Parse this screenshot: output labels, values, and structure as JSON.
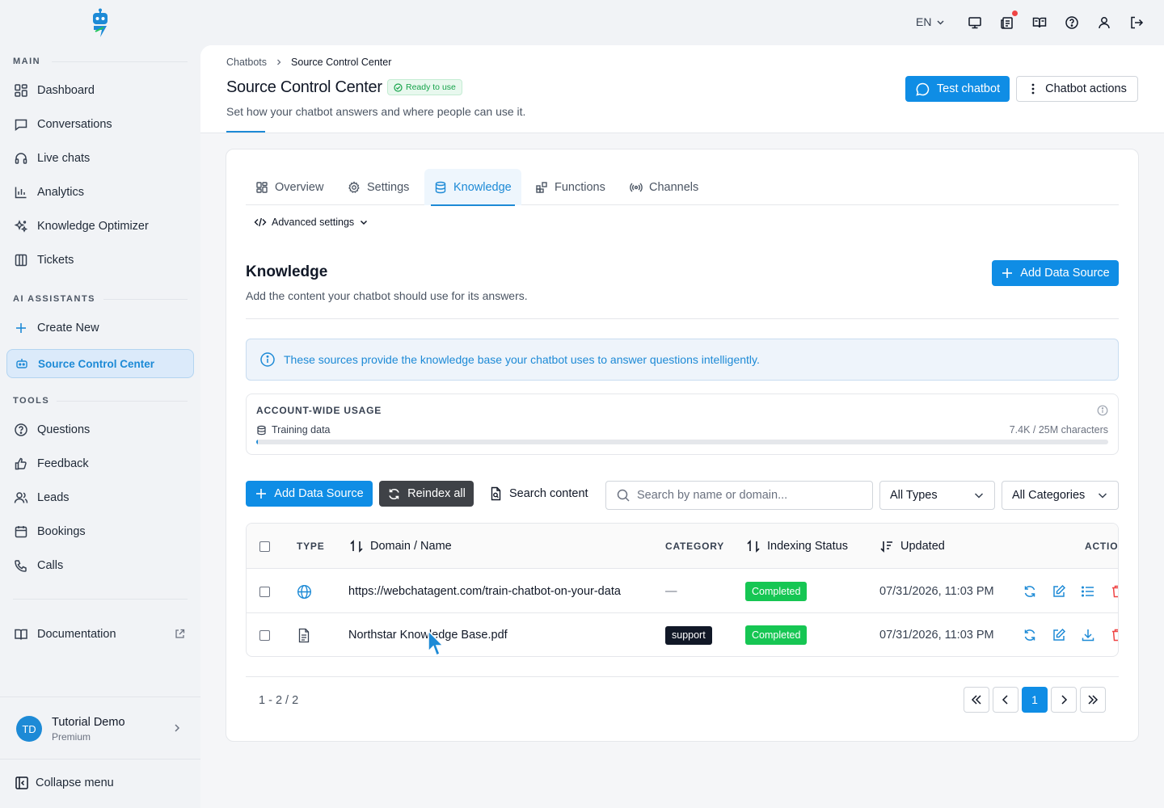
{
  "sidebar": {
    "sections": {
      "main": "MAIN",
      "ai_assistants": "AI ASSISTANTS",
      "tools": "TOOLS"
    },
    "main_items": [
      {
        "label": "Dashboard",
        "icon": "dashboard-icon"
      },
      {
        "label": "Conversations",
        "icon": "chat-icon"
      },
      {
        "label": "Live chats",
        "icon": "headset-icon"
      },
      {
        "label": "Analytics",
        "icon": "bar-chart-icon"
      },
      {
        "label": "Knowledge Optimizer",
        "icon": "sparkles-icon"
      },
      {
        "label": "Tickets",
        "icon": "columns-icon"
      }
    ],
    "create_new": "Create New",
    "active_assistant": "Source Control Center",
    "tool_items": [
      {
        "label": "Questions",
        "icon": "question-icon"
      },
      {
        "label": "Feedback",
        "icon": "thumbs-up-icon"
      },
      {
        "label": "Leads",
        "icon": "users-icon"
      },
      {
        "label": "Bookings",
        "icon": "calendar-icon"
      },
      {
        "label": "Calls",
        "icon": "phone-icon"
      }
    ],
    "documentation": "Documentation",
    "user": {
      "initials": "TD",
      "name": "Tutorial Demo",
      "plan": "Premium"
    },
    "collapse": "Collapse menu"
  },
  "topbar": {
    "language": "EN",
    "accent_dot_color": "#ef4444"
  },
  "header": {
    "breadcrumb": [
      "Chatbots",
      "Source Control Center"
    ],
    "title": "Source Control Center",
    "status_badge": "Ready to use",
    "subtitle": "Set how your chatbot answers and where people can use it.",
    "test_button": "Test chatbot",
    "actions_button": "Chatbot actions"
  },
  "tabs": [
    {
      "label": "Overview",
      "icon": "grid-icon"
    },
    {
      "label": "Settings",
      "icon": "gear-icon"
    },
    {
      "label": "Knowledge",
      "icon": "database-icon"
    },
    {
      "label": "Functions",
      "icon": "blocks-icon"
    },
    {
      "label": "Channels",
      "icon": "broadcast-icon"
    }
  ],
  "advanced_settings": "Advanced settings",
  "knowledge": {
    "title": "Knowledge",
    "subtitle": "Add the content your chatbot should use for its answers.",
    "add_source": "Add Data Source",
    "info": "These sources provide the knowledge base your chatbot uses to answer questions intelligently."
  },
  "usage": {
    "title": "ACCOUNT-WIDE USAGE",
    "label": "Training data",
    "value": "7.4K / 25M characters",
    "fraction": 0.0003
  },
  "toolbar": {
    "add_source": "Add Data Source",
    "reindex": "Reindex all",
    "search_content": "Search content",
    "search_placeholder": "Search by name or domain...",
    "type_filter": "All Types",
    "category_filter": "All Categories"
  },
  "table": {
    "columns": {
      "type": "TYPE",
      "name": "Domain / Name",
      "category": "CATEGORY",
      "status": "Indexing Status",
      "updated": "Updated",
      "actions": "ACTIONS"
    },
    "rows": [
      {
        "type_icon": "globe-icon",
        "name": "https://webchatagent.com/train-chatbot-on-your-data",
        "category": "—",
        "status": "Completed",
        "updated": "07/31/2026, 11:03 PM"
      },
      {
        "type_icon": "file-icon",
        "name": "Northstar Knowledge Base.pdf",
        "category": "support",
        "status": "Completed",
        "updated": "07/31/2026, 11:03 PM"
      }
    ]
  },
  "pagination": {
    "count": "1 - 2 / 2",
    "current": "1"
  },
  "colors": {
    "accent": "#1d8ad6",
    "primary_button": "#0f8de5",
    "success": "#16c653",
    "danger": "#ef4444"
  }
}
